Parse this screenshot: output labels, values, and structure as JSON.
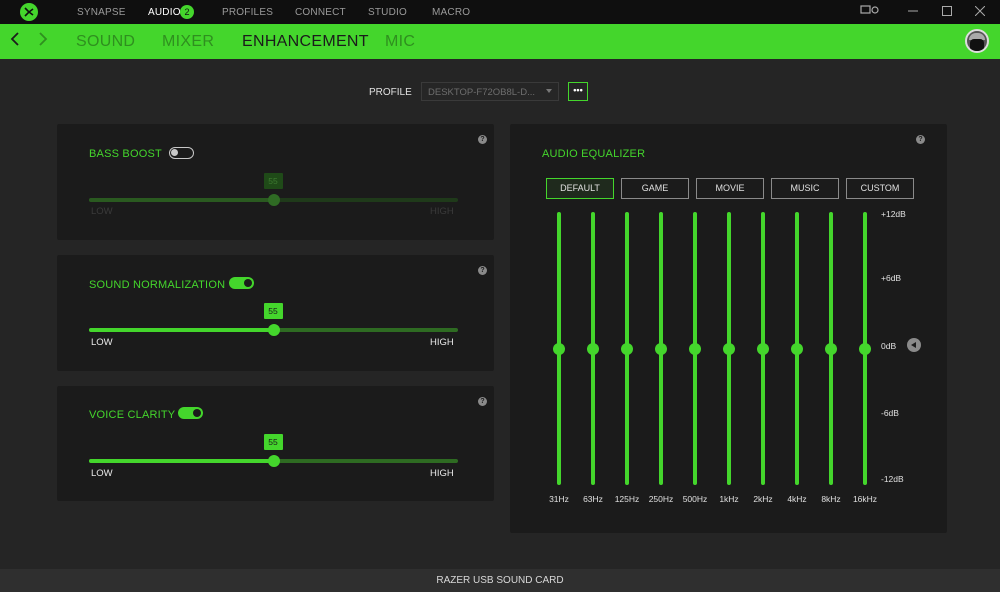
{
  "app": {
    "top_tabs": [
      {
        "label": "SYNAPSE"
      },
      {
        "label": "AUDIO"
      },
      {
        "label": "PROFILES"
      },
      {
        "label": "CONNECT"
      },
      {
        "label": "STUDIO"
      },
      {
        "label": "MACRO"
      }
    ],
    "audio_badge": "2",
    "active_top_tab": "AUDIO"
  },
  "sub_nav": {
    "tabs": [
      {
        "label": "SOUND"
      },
      {
        "label": "MIXER"
      },
      {
        "label": "ENHANCEMENT"
      },
      {
        "label": "MIC"
      }
    ],
    "active": "ENHANCEMENT"
  },
  "profile": {
    "label": "PROFILE",
    "value": "DESKTOP-F72OB8L-D...",
    "more_label": "•••"
  },
  "bass_boost": {
    "title": "BASS BOOST",
    "enabled": false,
    "value": "55",
    "level": 0.5,
    "low_label": "LOW",
    "high_label": "HIGH"
  },
  "sound_normalization": {
    "title": "SOUND NORMALIZATION",
    "enabled": true,
    "value": "55",
    "level": 0.5,
    "low_label": "LOW",
    "high_label": "HIGH"
  },
  "voice_clarity": {
    "title": "VOICE CLARITY",
    "enabled": true,
    "value": "55",
    "level": 0.5,
    "low_label": "LOW",
    "high_label": "HIGH"
  },
  "equalizer": {
    "title": "AUDIO EQUALIZER",
    "presets": [
      {
        "label": "DEFAULT"
      },
      {
        "label": "GAME"
      },
      {
        "label": "MOVIE"
      },
      {
        "label": "MUSIC"
      },
      {
        "label": "CUSTOM"
      }
    ],
    "active_preset": "DEFAULT",
    "db_labels": [
      "+12dB",
      "+6dB",
      "0dB",
      "-6dB",
      "-12dB"
    ],
    "bands": [
      {
        "freq": "31Hz",
        "gain_db": 0
      },
      {
        "freq": "63Hz",
        "gain_db": 0
      },
      {
        "freq": "125Hz",
        "gain_db": 0
      },
      {
        "freq": "250Hz",
        "gain_db": 0
      },
      {
        "freq": "500Hz",
        "gain_db": 0
      },
      {
        "freq": "1kHz",
        "gain_db": 0
      },
      {
        "freq": "2kHz",
        "gain_db": 0
      },
      {
        "freq": "4kHz",
        "gain_db": 0
      },
      {
        "freq": "8kHz",
        "gain_db": 0
      },
      {
        "freq": "16kHz",
        "gain_db": 0
      }
    ],
    "range_db": [
      -12,
      12
    ]
  },
  "status": {
    "device": "RAZER USB SOUND CARD"
  },
  "colors": {
    "accent": "#44d62c",
    "background": "#252525",
    "panel": "#1b1b1b"
  }
}
